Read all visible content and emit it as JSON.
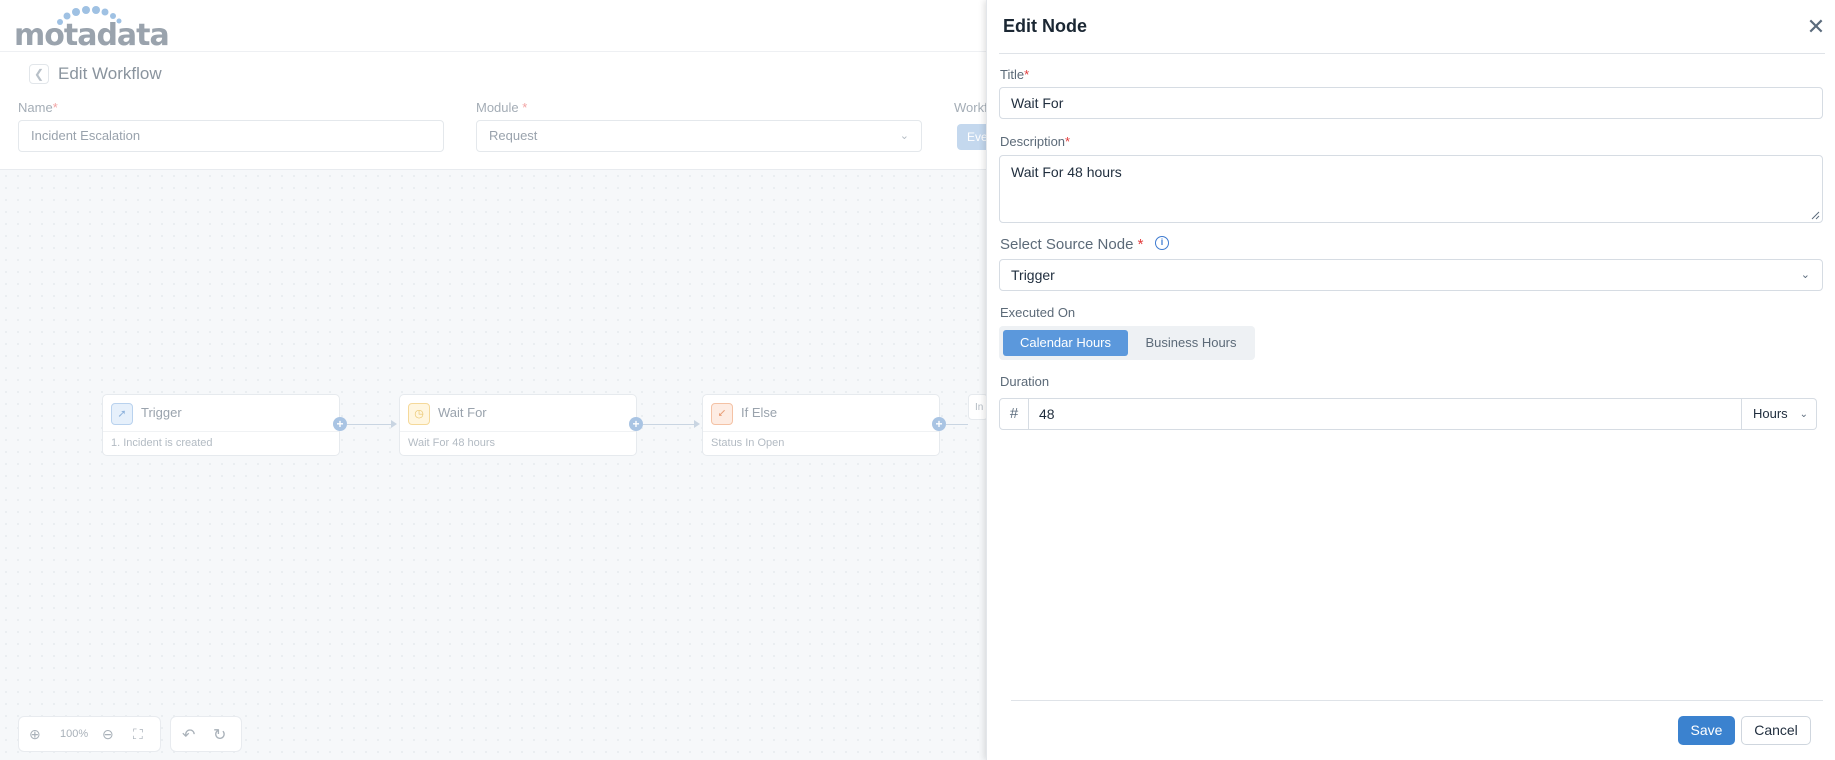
{
  "brand": {
    "logo_text": "motadata"
  },
  "workflow": {
    "back_icon": "chevron-left-icon",
    "title": "Edit Workflow",
    "name_label": "Name",
    "name_value": "Incident Escalation",
    "module_label": "Module",
    "module_value": "Request",
    "workflow_type_label": "Workfl",
    "workflow_type_button": "Eve"
  },
  "canvas": {
    "nodes": [
      {
        "title": "Trigger",
        "subtitle": "1. Incident is created",
        "icon": "rocket-icon"
      },
      {
        "title": "Wait For",
        "subtitle": "Wait For 48 hours",
        "icon": "clock-icon"
      },
      {
        "title": "If Else",
        "subtitle": "Status In Open",
        "icon": "branch-icon"
      }
    ],
    "peek_node_text": "In",
    "zoom_level": "100%"
  },
  "drawer": {
    "title": "Edit Node",
    "title_label": "Title",
    "title_value": "Wait For",
    "description_label": "Description",
    "description_value": "Wait For 48 hours",
    "source_node_label": "Select Source Node",
    "source_node_value": "Trigger",
    "executed_on_label": "Executed On",
    "executed_on_options": [
      "Calendar Hours",
      "Business Hours"
    ],
    "executed_on_selected": "Calendar Hours",
    "duration_label": "Duration",
    "duration_value": "48",
    "duration_unit": "Hours",
    "save_label": "Save",
    "cancel_label": "Cancel",
    "required_mark": "*"
  },
  "colors": {
    "accent": "#3b82cf",
    "segment_active": "#5b98dc",
    "required": "#e23b3b"
  }
}
